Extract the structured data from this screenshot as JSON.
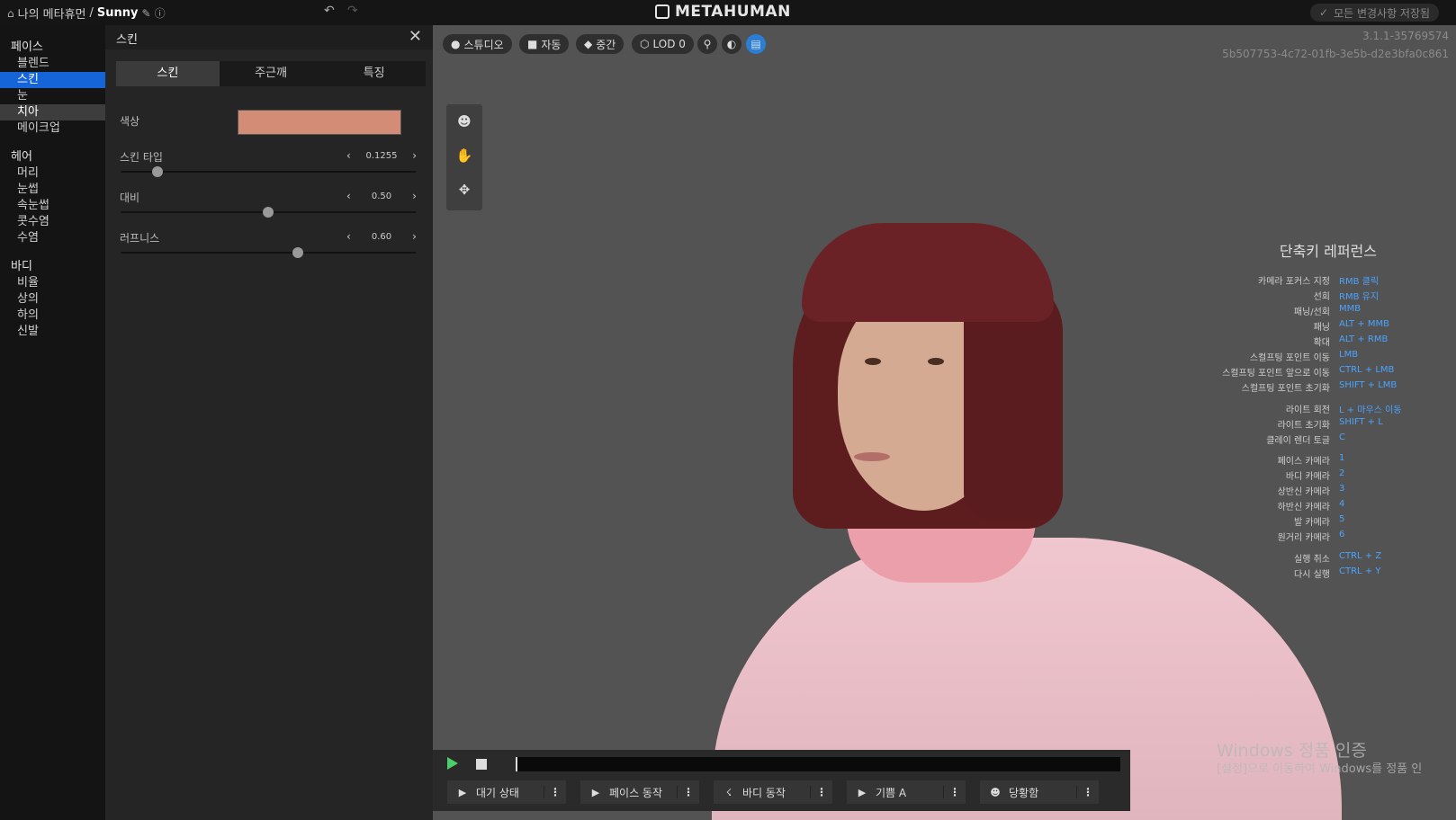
{
  "topbar": {
    "breadcrumb_home": "나의 메타휴먼",
    "breadcrumb_sep": "/",
    "breadcrumb_name": "Sunny",
    "logo": "METAHUMAN",
    "save_status": "모든 변경사항 저장됨"
  },
  "nav": {
    "groups": [
      {
        "label": "페이스",
        "items": [
          "블렌드",
          "스킨",
          "눈",
          "치아",
          "메이크업"
        ]
      },
      {
        "label": "헤어",
        "items": [
          "머리",
          "눈썹",
          "속눈썹",
          "콧수염",
          "수염"
        ]
      },
      {
        "label": "바디",
        "items": [
          "비율",
          "상의",
          "하의",
          "신발"
        ]
      }
    ]
  },
  "panel": {
    "title": "스킨",
    "tabs": [
      "스킨",
      "주근깨",
      "특징"
    ],
    "color_label": "색상",
    "color_value": "#d38d76",
    "sliders": [
      {
        "label": "스킨 타입",
        "value": "0.1255",
        "fraction": 0.1255
      },
      {
        "label": "대비",
        "value": "0.50",
        "fraction": 0.5
      },
      {
        "label": "러프니스",
        "value": "0.60",
        "fraction": 0.6
      }
    ]
  },
  "viewport": {
    "toolbar": [
      "스튜디오",
      "자동",
      "중간",
      "LOD 0"
    ],
    "version": "3.1.1-35769574",
    "guid": "5b507753-4c72-01fb-3e5b-d2e3bfa0c861"
  },
  "shortcuts": {
    "title": "단축키 레퍼런스",
    "rows": [
      {
        "k": "카메라 포커스 지정",
        "v": "RMB 클릭"
      },
      {
        "k": "선회",
        "v": "RMB 유지"
      },
      {
        "k": "패닝/선회",
        "v": "MMB"
      },
      {
        "k": "패닝",
        "v": "ALT + MMB"
      },
      {
        "k": "확대",
        "v": "ALT + RMB"
      },
      {
        "k": "스컬프팅 포인트 이동",
        "v": "LMB"
      },
      {
        "k": "스컬프팅 포인트 앞으로 이동",
        "v": "CTRL + LMB"
      },
      {
        "k": "스컬프팅 포인트 초기화",
        "v": "SHIFT + LMB"
      },
      {
        "k": "라이트 회전",
        "v": "L + 마우스 이동"
      },
      {
        "k": "라이트 초기화",
        "v": "SHIFT + L"
      },
      {
        "k": "클레이 렌더 토글",
        "v": "C"
      },
      {
        "k": "페이스 카메라",
        "v": "1"
      },
      {
        "k": "바디 카메라",
        "v": "2"
      },
      {
        "k": "상반신 카메라",
        "v": "3"
      },
      {
        "k": "하반신 카메라",
        "v": "4"
      },
      {
        "k": "발 카메라",
        "v": "5"
      },
      {
        "k": "원거리 카메라",
        "v": "6"
      },
      {
        "k": "실행 취소",
        "v": "CTRL + Z"
      },
      {
        "k": "다시 실행",
        "v": "CTRL + Y"
      }
    ]
  },
  "watermark": {
    "title": "Windows 정품 인증",
    "subtitle": "[설정]으로 이동하여 Windows를 정품 인"
  },
  "timeline": {
    "clips": [
      "대기 상태",
      "페이스 동작",
      "바디 동작",
      "기쁨 A",
      "당황함"
    ]
  }
}
